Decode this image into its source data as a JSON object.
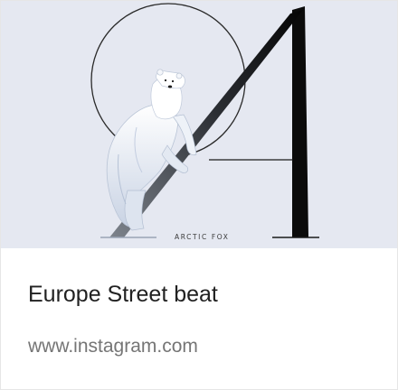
{
  "card": {
    "title": "Europe Street beat",
    "domain": "www.instagram.com",
    "image": {
      "caption_tag": "ARCTIC FOX",
      "letter": "A",
      "icon": "polar-bear-climbing-letter-illustration"
    }
  },
  "colors": {
    "thumbnail_background": "#e5e8f1",
    "title_text": "#212121",
    "domain_text": "#757575",
    "letter_fill": "#0b0b0b"
  }
}
